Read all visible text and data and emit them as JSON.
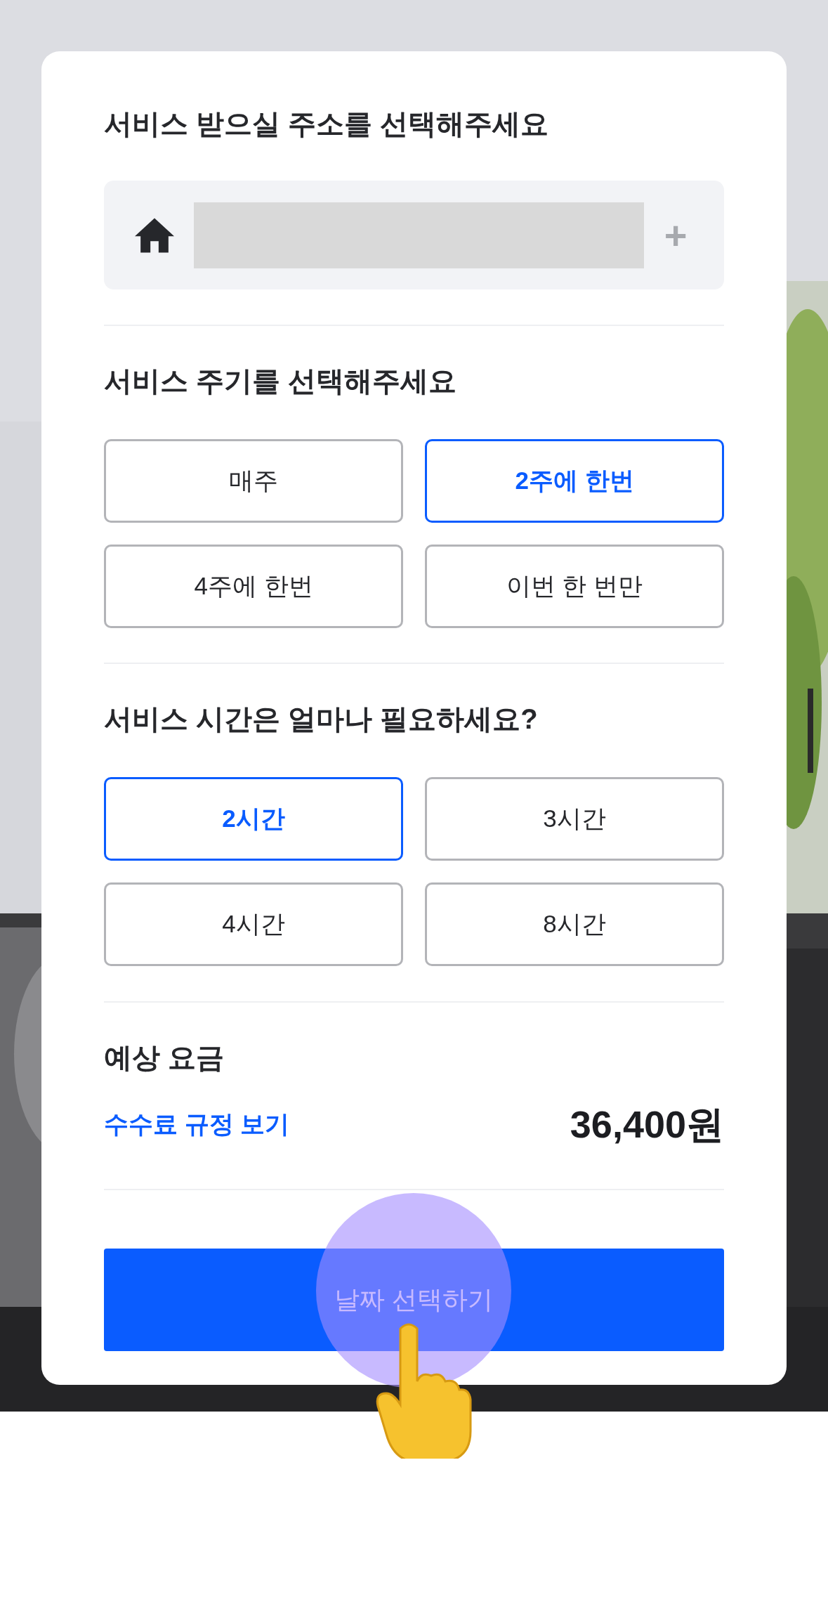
{
  "address_section": {
    "title": "서비스 받으실 주소를 선택해주세요",
    "add_symbol": "+"
  },
  "frequency_section": {
    "title": "서비스 주기를 선택해주세요",
    "options": [
      {
        "label": "매주",
        "selected": false
      },
      {
        "label": "2주에 한번",
        "selected": true
      },
      {
        "label": "4주에 한번",
        "selected": false
      },
      {
        "label": "이번 한 번만",
        "selected": false
      }
    ]
  },
  "duration_section": {
    "title": "서비스 시간은 얼마나 필요하세요?",
    "options": [
      {
        "label": "2시간",
        "selected": true
      },
      {
        "label": "3시간",
        "selected": false
      },
      {
        "label": "4시간",
        "selected": false
      },
      {
        "label": "8시간",
        "selected": false
      }
    ]
  },
  "price_section": {
    "title": "예상 요금",
    "fee_link": "수수료 규정 보기",
    "price": "36,400원"
  },
  "primary_button": {
    "label": "날짜 선택하기"
  }
}
